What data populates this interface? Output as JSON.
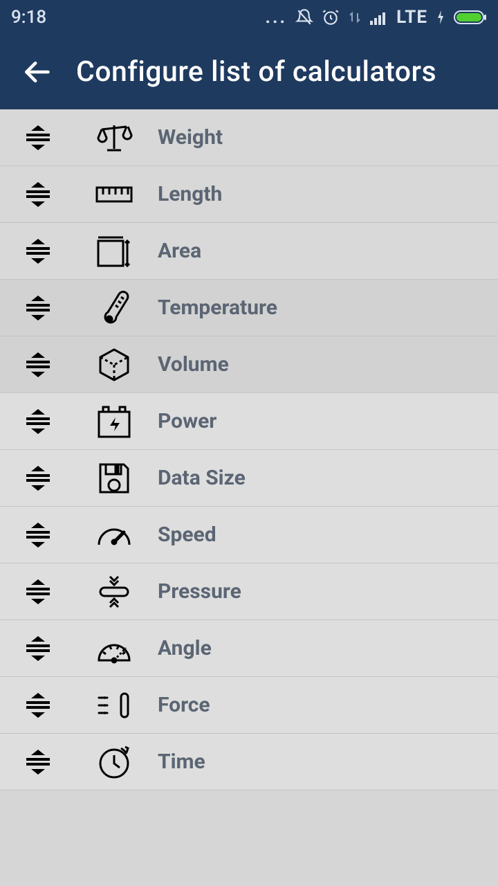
{
  "statusbar": {
    "time": "9:18",
    "network_label": "LTE"
  },
  "header": {
    "title": "Configure list of calculators"
  },
  "list": {
    "items": [
      {
        "label": "Weight",
        "icon": "scale-icon"
      },
      {
        "label": "Length",
        "icon": "ruler-icon"
      },
      {
        "label": "Area",
        "icon": "area-icon"
      },
      {
        "label": "Temperature",
        "icon": "thermometer-icon"
      },
      {
        "label": "Volume",
        "icon": "cube-icon"
      },
      {
        "label": "Power",
        "icon": "battery-power-icon"
      },
      {
        "label": "Data Size",
        "icon": "floppy-icon"
      },
      {
        "label": "Speed",
        "icon": "gauge-icon"
      },
      {
        "label": "Pressure",
        "icon": "pressure-icon"
      },
      {
        "label": "Angle",
        "icon": "protractor-icon"
      },
      {
        "label": "Force",
        "icon": "force-icon"
      },
      {
        "label": "Time",
        "icon": "clock-icon"
      }
    ]
  },
  "colors": {
    "header_bg": "#1f3a5f",
    "text_muted": "#5b6573",
    "battery_fill": "#52d030"
  }
}
